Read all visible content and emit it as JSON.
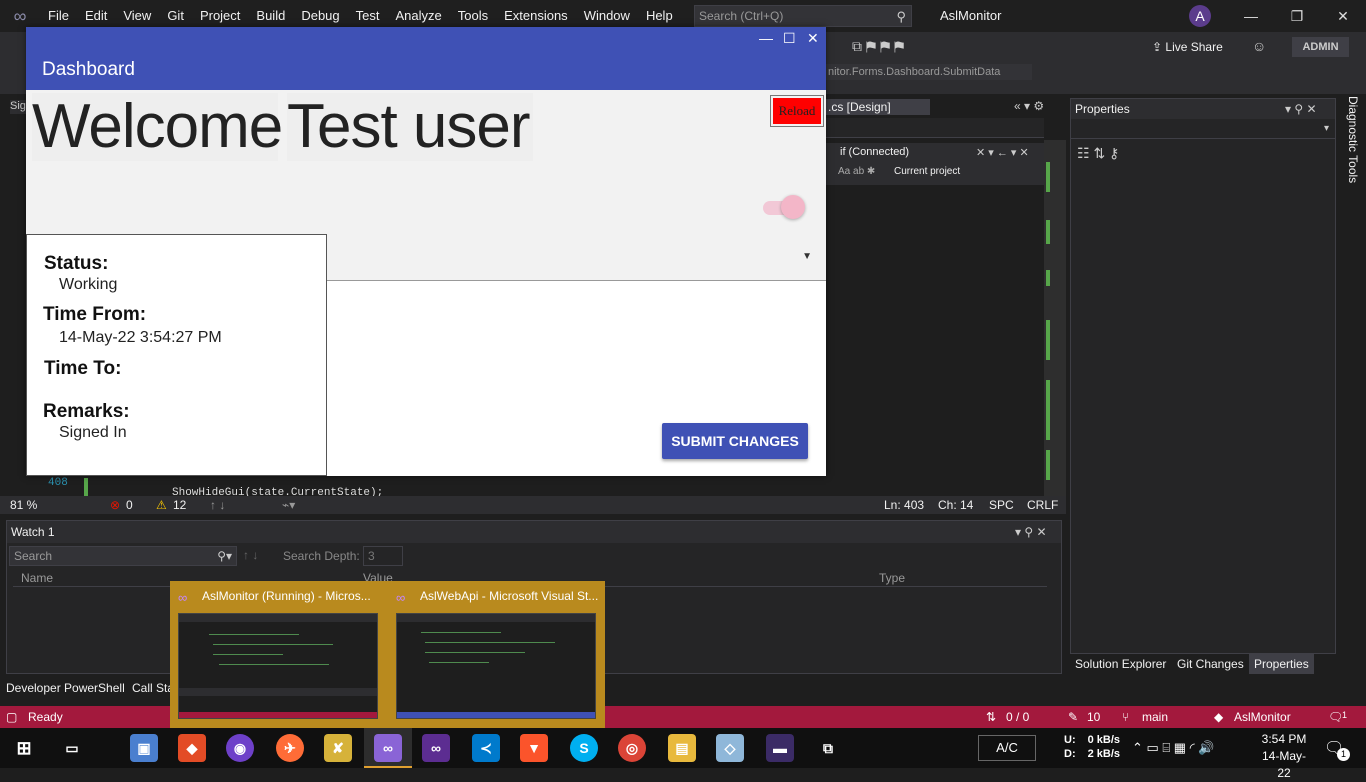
{
  "vs": {
    "menu": [
      "File",
      "Edit",
      "View",
      "Git",
      "Project",
      "Build",
      "Debug",
      "Test",
      "Analyze",
      "Tools",
      "Extensions",
      "Window",
      "Help"
    ],
    "search_placeholder": "Search (Ctrl+Q)",
    "title": "AslMonitor",
    "avatar_letter": "A",
    "live_share": "Live Share",
    "admin": "ADMIN",
    "doc_path": "nitor.Forms.Dashboard.SubmitData",
    "design_tab": ".cs [Design]",
    "find_query": "if (Connected)",
    "find_scope": "Current project",
    "line_number": "408",
    "code_text": "ShowHideGui(state.CurrentState);",
    "editor_status": {
      "zoom": "81 %",
      "errors": "0",
      "warnings": "12",
      "ln": "Ln: 403",
      "ch": "Ch: 14",
      "spc": "SPC",
      "crlf": "CRLF"
    },
    "properties_title": "Properties",
    "diagnostic_tools": "Diagnostic Tools",
    "props_tabs": [
      "Solution Explorer",
      "Git Changes",
      "Properties"
    ],
    "watch": {
      "title": "Watch 1",
      "search": "Search",
      "search_depth": "Search Depth:",
      "depth": "3",
      "cols": [
        "Name",
        "Value",
        "Type"
      ]
    },
    "bottom_tabs": [
      "Developer PowerShell",
      "Call Sta"
    ],
    "status": {
      "ready": "Ready",
      "git_changes": "0 / 0",
      "pending": "10",
      "branch": "main",
      "repo": "AslMonitor",
      "notif": "1"
    }
  },
  "thumbs": [
    {
      "title": "AslMonitor (Running) - Micros..."
    },
    {
      "title": "AslWebApi - Microsoft Visual St..."
    }
  ],
  "taskbar": {
    "ac": "A/C",
    "net_up_label": "U:",
    "net_down_label": "D:",
    "net_up": "0 kB/s",
    "net_down": "2 kB/s",
    "time": "3:54 PM",
    "date": "14-May-22",
    "notif_count": "1"
  },
  "dashboard": {
    "header": "Dashboard",
    "welcome": "Welcome",
    "username": "Test user",
    "reload": "Reload",
    "submit": "SUBMIT CHANGES",
    "card": {
      "status_label": "Status:",
      "status_value": "Working",
      "from_label": "Time From:",
      "from_value": "14-May-22 3:54:27 PM",
      "to_label": "Time To:",
      "to_value": "",
      "remarks_label": "Remarks:",
      "remarks_value": "Signed In"
    }
  },
  "colors": {
    "material_primary": "#3f51b5",
    "reload_red": "#ff0000",
    "status_bar": "#a3193d",
    "thumb_bg": "#b98a1e"
  }
}
